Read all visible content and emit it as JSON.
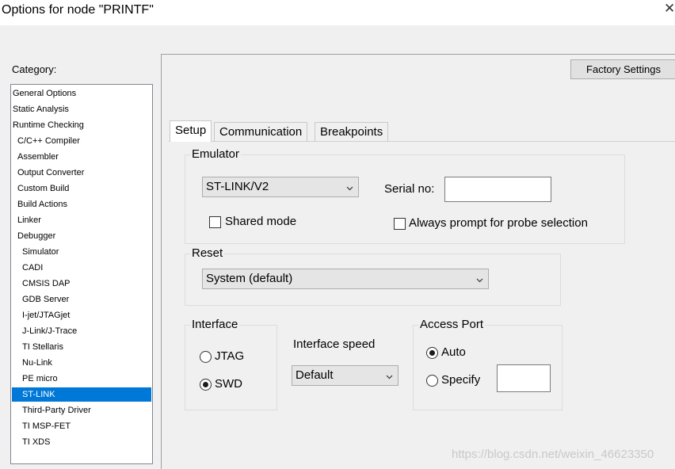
{
  "window": {
    "title": "Options for node \"PRINTF\"",
    "close_glyph": "✕"
  },
  "category": {
    "label": "Category:",
    "items": [
      {
        "label": "General Options",
        "level": 0
      },
      {
        "label": "Static Analysis",
        "level": 0
      },
      {
        "label": "Runtime Checking",
        "level": 0
      },
      {
        "label": "C/C++ Compiler",
        "level": 1
      },
      {
        "label": "Assembler",
        "level": 1
      },
      {
        "label": "Output Converter",
        "level": 1
      },
      {
        "label": "Custom Build",
        "level": 1
      },
      {
        "label": "Build Actions",
        "level": 1
      },
      {
        "label": "Linker",
        "level": 1
      },
      {
        "label": "Debugger",
        "level": 1
      },
      {
        "label": "Simulator",
        "level": 2
      },
      {
        "label": "CADI",
        "level": 2
      },
      {
        "label": "CMSIS DAP",
        "level": 2
      },
      {
        "label": "GDB Server",
        "level": 2
      },
      {
        "label": "I-jet/JTAGjet",
        "level": 2
      },
      {
        "label": "J-Link/J-Trace",
        "level": 2
      },
      {
        "label": "TI Stellaris",
        "level": 2
      },
      {
        "label": "Nu-Link",
        "level": 2
      },
      {
        "label": "PE micro",
        "level": 2
      },
      {
        "label": "ST-LINK",
        "level": 2,
        "selected": true
      },
      {
        "label": "Third-Party Driver",
        "level": 2
      },
      {
        "label": "TI MSP-FET",
        "level": 2
      },
      {
        "label": "TI XDS",
        "level": 2
      }
    ]
  },
  "factory_settings_label": "Factory Settings",
  "tabs": [
    "Setup",
    "Communication",
    "Breakpoints"
  ],
  "active_tab": "Setup",
  "emulator": {
    "title": "Emulator",
    "selected": "ST-LINK/V2",
    "serial_label": "Serial no:",
    "serial_value": "",
    "shared_mode_label": "Shared mode",
    "shared_mode_checked": false,
    "always_prompt_label": "Always prompt for probe selection",
    "always_prompt_checked": false
  },
  "reset": {
    "title": "Reset",
    "selected": "System (default)"
  },
  "interface": {
    "title": "Interface",
    "options": [
      "JTAG",
      "SWD"
    ],
    "selected": "SWD"
  },
  "interface_speed": {
    "label": "Interface speed",
    "selected": "Default"
  },
  "access_port": {
    "title": "Access Port",
    "options": [
      "Auto",
      "Specify"
    ],
    "selected": "Auto",
    "specify_value": ""
  },
  "watermark": "https://blog.csdn.net/weixin_46623350",
  "colors": {
    "selection": "#0078d7",
    "window_bg": "#f0f0f0"
  }
}
